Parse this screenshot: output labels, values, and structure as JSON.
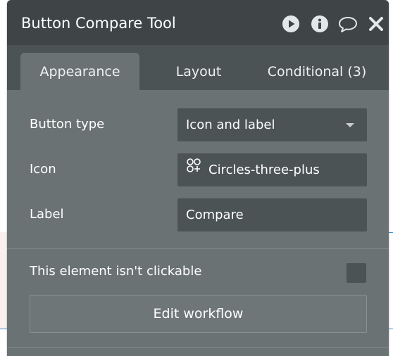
{
  "window": {
    "title": "Button Compare Tool"
  },
  "title_actions": [
    {
      "icon": "play-icon"
    },
    {
      "icon": "info-icon"
    },
    {
      "icon": "comment-icon"
    },
    {
      "icon": "close-icon"
    }
  ],
  "tabs": [
    {
      "label": "Appearance",
      "active": true
    },
    {
      "label": "Layout",
      "active": false
    },
    {
      "label": "Conditional (3)",
      "active": false
    }
  ],
  "fields": {
    "button_type": {
      "label": "Button type",
      "value": "Icon and label"
    },
    "icon": {
      "label": "Icon",
      "value": "Circles-three-plus",
      "icon": "circles-three-plus-icon"
    },
    "label": {
      "label": "Label",
      "value": "Compare"
    }
  },
  "clickable": {
    "label": "This element isn't clickable",
    "checked": false
  },
  "workflow_button": {
    "label": "Edit workflow"
  },
  "colors": {
    "title_bar": "#3f4547",
    "tab_bar": "#4c5355",
    "panel": "#6a7273",
    "field": "#4c5355",
    "canvas_guide": "#3f8ecf"
  }
}
